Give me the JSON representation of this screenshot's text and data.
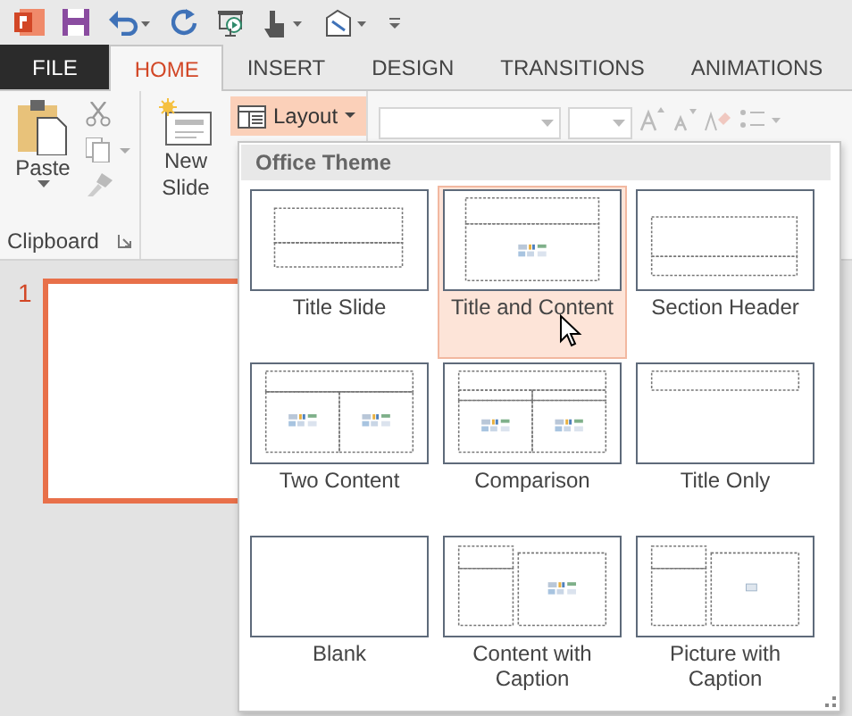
{
  "tabs": [
    {
      "label": "FILE",
      "kind": "file",
      "selected": false
    },
    {
      "label": "HOME",
      "kind": "tab",
      "selected": true
    },
    {
      "label": "INSERT",
      "kind": "tab",
      "selected": false
    },
    {
      "label": "DESIGN",
      "kind": "tab",
      "selected": false
    },
    {
      "label": "TRANSITIONS",
      "kind": "tab",
      "selected": false
    },
    {
      "label": "ANIMATIONS",
      "kind": "tab",
      "selected": false
    }
  ],
  "clipboard": {
    "paste": "Paste",
    "group_label": "Clipboard"
  },
  "slides": {
    "new_slide": "New Slide",
    "layout": "Layout"
  },
  "slide_panel": {
    "number": "1"
  },
  "layout_gallery": {
    "heading": "Office Theme",
    "items": [
      {
        "label": "Title Slide",
        "kind": "title",
        "selected": false
      },
      {
        "label": "Title and Content",
        "kind": "title-content",
        "selected": true
      },
      {
        "label": "Section Header",
        "kind": "section",
        "selected": false
      },
      {
        "label": "Two Content",
        "kind": "two-content",
        "selected": false
      },
      {
        "label": "Comparison",
        "kind": "comparison",
        "selected": false
      },
      {
        "label": "Title Only",
        "kind": "title-only",
        "selected": false
      },
      {
        "label": "Blank",
        "kind": "blank",
        "selected": false
      },
      {
        "label": "Content with Caption",
        "kind": "content-caption",
        "selected": false
      },
      {
        "label": "Picture with Caption",
        "kind": "picture-caption",
        "selected": false
      }
    ]
  }
}
